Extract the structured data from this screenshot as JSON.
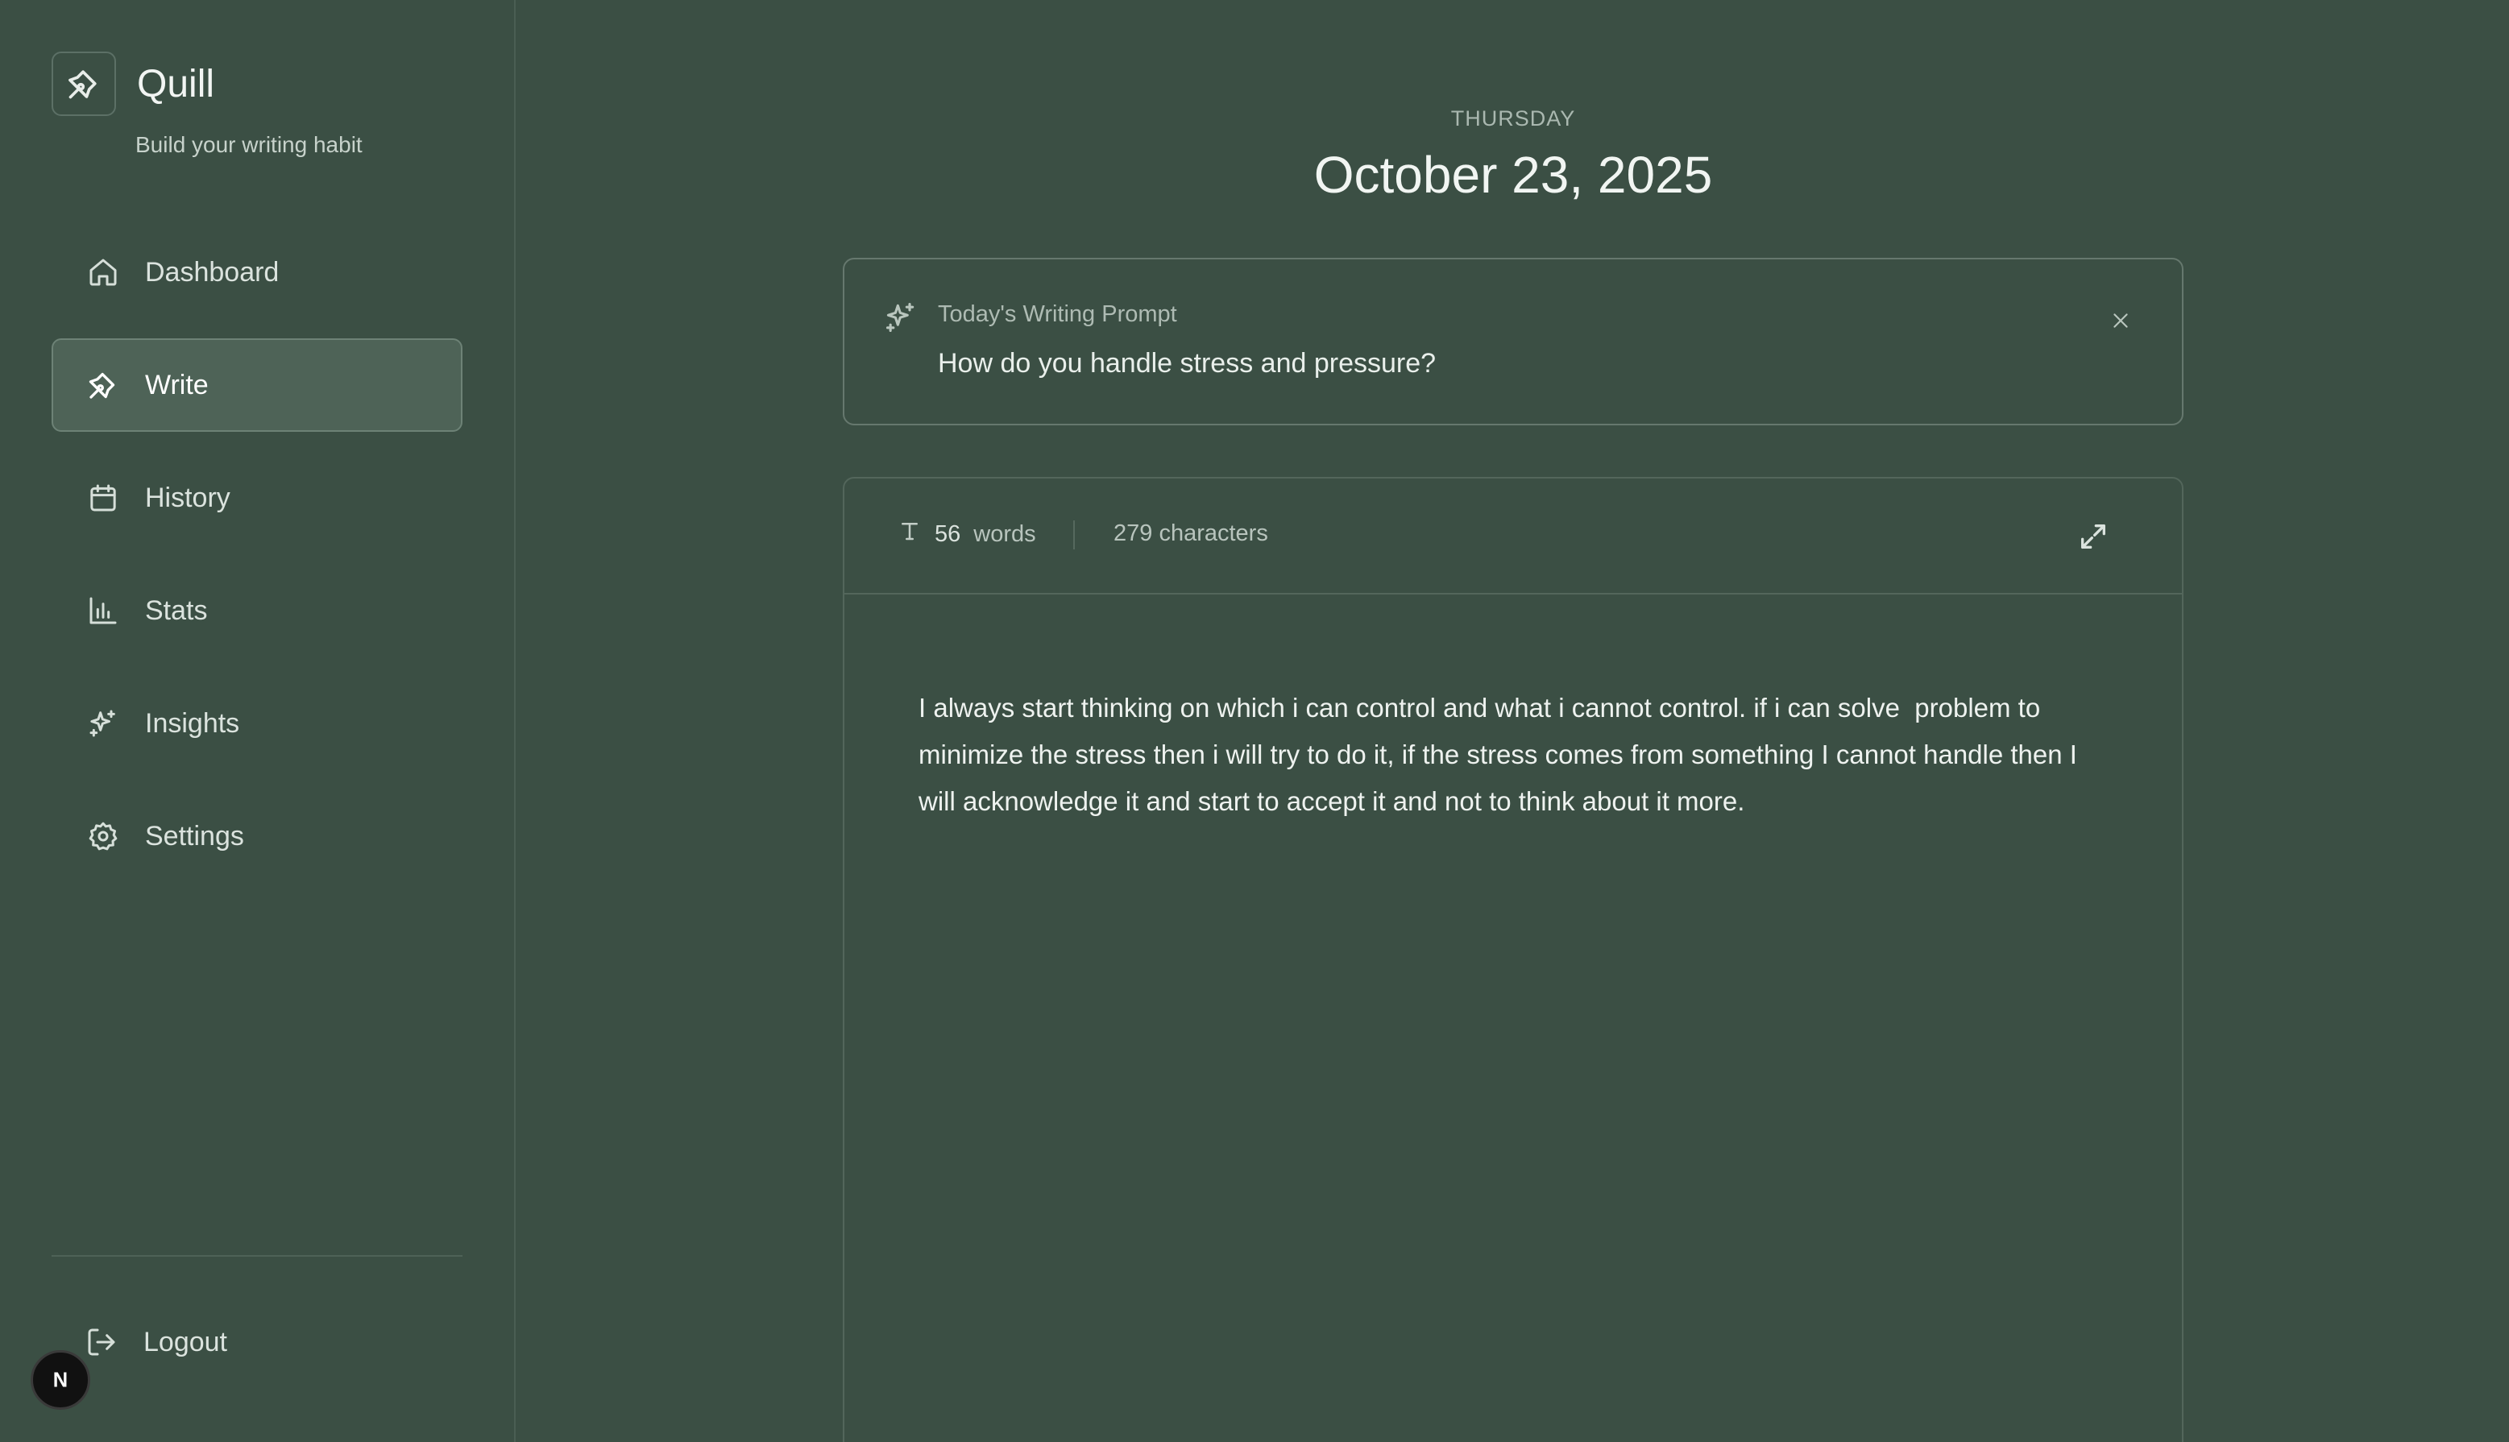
{
  "brand": {
    "name": "Quill",
    "tagline": "Build your writing habit"
  },
  "nav": {
    "items": [
      {
        "label": "Dashboard",
        "icon": "home-icon"
      },
      {
        "label": "Write",
        "icon": "pen-icon",
        "active": true
      },
      {
        "label": "History",
        "icon": "calendar-icon"
      },
      {
        "label": "Stats",
        "icon": "bar-chart-icon"
      },
      {
        "label": "Insights",
        "icon": "sparkles-icon"
      },
      {
        "label": "Settings",
        "icon": "gear-icon"
      }
    ],
    "logout_label": "Logout"
  },
  "badge": {
    "letter": "N"
  },
  "header": {
    "day": "THURSDAY",
    "date": "October 23, 2025"
  },
  "prompt": {
    "label": "Today's Writing Prompt",
    "text": "How do you handle stress and pressure?"
  },
  "editor": {
    "word_count": "56",
    "words_label": "words",
    "characters": "279 characters",
    "content": "I always start thinking on which i can control and what i cannot control. if i can solve  problem to minimize the stress then i will try to do it, if the stress comes from something I cannot handle then I will acknowledge it and start to accept it and not to think about it more."
  },
  "colors": {
    "background": "#3b4f44",
    "active_nav": "#4e6357",
    "text": "#e8ede9"
  }
}
